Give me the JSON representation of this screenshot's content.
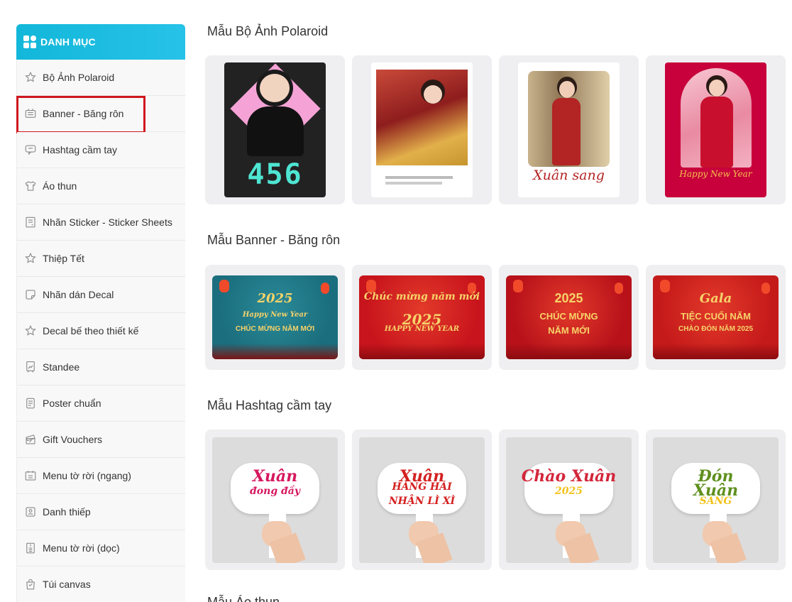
{
  "sidebar": {
    "header": "DANH MỤC",
    "items": [
      {
        "label": "Bộ Ảnh Polaroid",
        "icon": "star-icon"
      },
      {
        "label": "Banner - Băng rôn",
        "icon": "banner-icon"
      },
      {
        "label": "Hashtag cầm tay",
        "icon": "speech-bubble-icon"
      },
      {
        "label": "Áo thun",
        "icon": "tshirt-icon"
      },
      {
        "label": "Nhãn Sticker - Sticker Sheets",
        "icon": "sticker-sheet-icon"
      },
      {
        "label": "Thiệp Tết",
        "icon": "star-icon"
      },
      {
        "label": "Nhãn dán Decal",
        "icon": "decal-icon"
      },
      {
        "label": "Decal bế theo thiết kế",
        "icon": "star-icon"
      },
      {
        "label": "Standee",
        "icon": "standee-icon"
      },
      {
        "label": "Poster chuẩn",
        "icon": "poster-icon"
      },
      {
        "label": "Gift Vouchers",
        "icon": "voucher-icon"
      },
      {
        "label": "Menu tờ rời (ngang)",
        "icon": "menu-horizontal-icon"
      },
      {
        "label": "Danh thiếp",
        "icon": "business-card-icon"
      },
      {
        "label": "Menu tờ rời (dọc)",
        "icon": "menu-vertical-icon"
      },
      {
        "label": "Túi canvas",
        "icon": "bag-icon"
      }
    ]
  },
  "sections": [
    {
      "title": "Mẫu Bộ Ảnh Polaroid"
    },
    {
      "title": "Mẫu Banner - Băng rôn"
    },
    {
      "title": "Mẫu Hashtag cầm tay"
    },
    {
      "title": "Mẫu Áo thun"
    }
  ],
  "polaroid_cards": [
    {
      "text": "456",
      "colors": [
        "#222222",
        "#f5a3d6",
        "#4ee6d3"
      ]
    },
    {
      "text": "",
      "colors": [
        "#ffffff",
        "#c8202a",
        "#f2c94c"
      ]
    },
    {
      "text": "Xuân sang",
      "colors": [
        "#ffffff",
        "#b32424",
        "#d9c3a0"
      ]
    },
    {
      "text": "Happy New Year",
      "colors": [
        "#c8003b",
        "#f3a4b8",
        "#f3c54b"
      ]
    }
  ],
  "banner_cards": [
    {
      "lines": [
        "2025",
        "Happy New Year",
        "CHÚC MỪNG NĂM MỚI"
      ],
      "bg": "#1b6e7d"
    },
    {
      "lines": [
        "Chúc mừng năm mới",
        "2025",
        "HAPPY NEW YEAR"
      ],
      "bg": "#c8141c"
    },
    {
      "lines": [
        "2025",
        "CHÚC MỪNG",
        "NĂM MỚI"
      ],
      "bg": "#b8111a"
    },
    {
      "lines": [
        "Gala",
        "TIỆC CUỐI NĂM",
        "CHÀO ĐÓN NĂM 2025"
      ],
      "bg": "#c51a1a"
    }
  ],
  "hashtag_cards": [
    {
      "lines": [
        "Xuân",
        "đong đầy"
      ],
      "color": "#d6185f"
    },
    {
      "lines": [
        "Xuân",
        "HÁNG HÁI",
        "NHẬN LÌ XÌ"
      ],
      "color": "#d42020"
    },
    {
      "lines": [
        "Chào Xuân",
        "2025"
      ],
      "color": "#d3263a"
    },
    {
      "lines": [
        "Đón",
        "Xuân",
        "SANG"
      ],
      "color": "#5f8f1e"
    }
  ]
}
